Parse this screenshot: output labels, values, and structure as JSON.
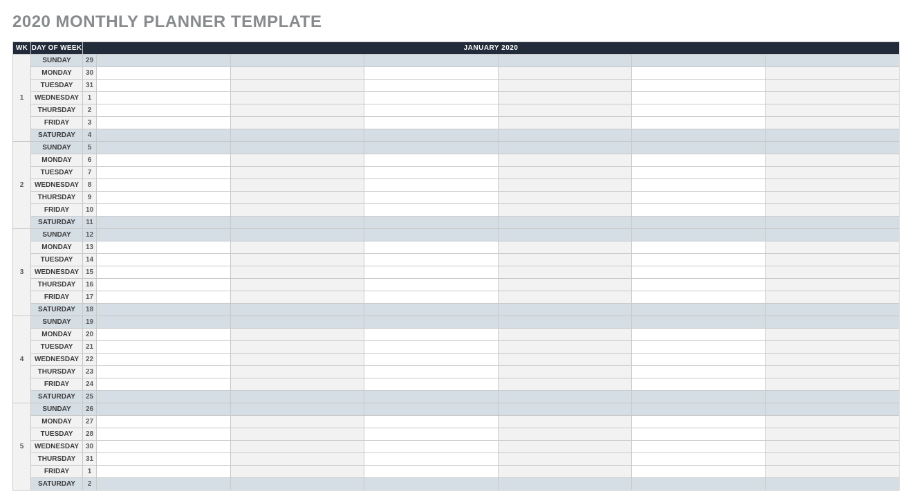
{
  "title": "2020 MONTHLY PLANNER TEMPLATE",
  "headers": {
    "wk": "WK",
    "dow": "DAY OF WEEK",
    "month": "JANUARY 2020"
  },
  "eventColumns": 6,
  "weeks": [
    {
      "wk": "1",
      "days": [
        {
          "dow": "SUNDAY",
          "num": "29",
          "weekend": true
        },
        {
          "dow": "MONDAY",
          "num": "30",
          "weekend": false
        },
        {
          "dow": "TUESDAY",
          "num": "31",
          "weekend": false
        },
        {
          "dow": "WEDNESDAY",
          "num": "1",
          "weekend": false
        },
        {
          "dow": "THURSDAY",
          "num": "2",
          "weekend": false
        },
        {
          "dow": "FRIDAY",
          "num": "3",
          "weekend": false
        },
        {
          "dow": "SATURDAY",
          "num": "4",
          "weekend": true
        }
      ]
    },
    {
      "wk": "2",
      "days": [
        {
          "dow": "SUNDAY",
          "num": "5",
          "weekend": true
        },
        {
          "dow": "MONDAY",
          "num": "6",
          "weekend": false
        },
        {
          "dow": "TUESDAY",
          "num": "7",
          "weekend": false
        },
        {
          "dow": "WEDNESDAY",
          "num": "8",
          "weekend": false
        },
        {
          "dow": "THURSDAY",
          "num": "9",
          "weekend": false
        },
        {
          "dow": "FRIDAY",
          "num": "10",
          "weekend": false
        },
        {
          "dow": "SATURDAY",
          "num": "11",
          "weekend": true
        }
      ]
    },
    {
      "wk": "3",
      "days": [
        {
          "dow": "SUNDAY",
          "num": "12",
          "weekend": true
        },
        {
          "dow": "MONDAY",
          "num": "13",
          "weekend": false
        },
        {
          "dow": "TUESDAY",
          "num": "14",
          "weekend": false
        },
        {
          "dow": "WEDNESDAY",
          "num": "15",
          "weekend": false
        },
        {
          "dow": "THURSDAY",
          "num": "16",
          "weekend": false
        },
        {
          "dow": "FRIDAY",
          "num": "17",
          "weekend": false
        },
        {
          "dow": "SATURDAY",
          "num": "18",
          "weekend": true
        }
      ]
    },
    {
      "wk": "4",
      "days": [
        {
          "dow": "SUNDAY",
          "num": "19",
          "weekend": true
        },
        {
          "dow": "MONDAY",
          "num": "20",
          "weekend": false
        },
        {
          "dow": "TUESDAY",
          "num": "21",
          "weekend": false
        },
        {
          "dow": "WEDNESDAY",
          "num": "22",
          "weekend": false
        },
        {
          "dow": "THURSDAY",
          "num": "23",
          "weekend": false
        },
        {
          "dow": "FRIDAY",
          "num": "24",
          "weekend": false
        },
        {
          "dow": "SATURDAY",
          "num": "25",
          "weekend": true
        }
      ]
    },
    {
      "wk": "5",
      "days": [
        {
          "dow": "SUNDAY",
          "num": "26",
          "weekend": true
        },
        {
          "dow": "MONDAY",
          "num": "27",
          "weekend": false
        },
        {
          "dow": "TUESDAY",
          "num": "28",
          "weekend": false
        },
        {
          "dow": "WEDNESDAY",
          "num": "30",
          "weekend": false
        },
        {
          "dow": "THURSDAY",
          "num": "31",
          "weekend": false
        },
        {
          "dow": "FRIDAY",
          "num": "1",
          "weekend": false
        },
        {
          "dow": "SATURDAY",
          "num": "2",
          "weekend": true
        }
      ]
    }
  ]
}
